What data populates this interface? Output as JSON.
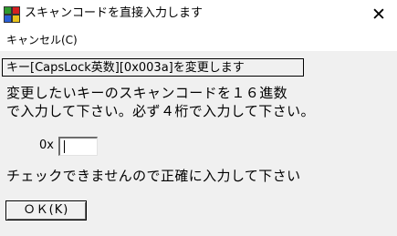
{
  "window": {
    "title": "スキャンコードを直接入力します",
    "icon": "app-grid-icon",
    "close_glyph": "✕"
  },
  "menu": {
    "items": [
      {
        "label": "キャンセル(C)"
      }
    ]
  },
  "content": {
    "header": "キー[CapsLock英数][0x003a]を変更します",
    "description_line1": "変更したいキーのスキャンコードを１６進数",
    "description_line2": "で入力して下さい。必ず４桁で入力して下さい。",
    "hex_prefix": "0x",
    "hex_value": "",
    "warning": "チェックできませんので正確に入力して下さい",
    "ok_label": "ＯＫ(K)"
  },
  "colors": {
    "icon_green": "#2e9a2e",
    "icon_red": "#d42020",
    "icon_blue": "#2a5fd6",
    "icon_yellow": "#e8c21a"
  }
}
